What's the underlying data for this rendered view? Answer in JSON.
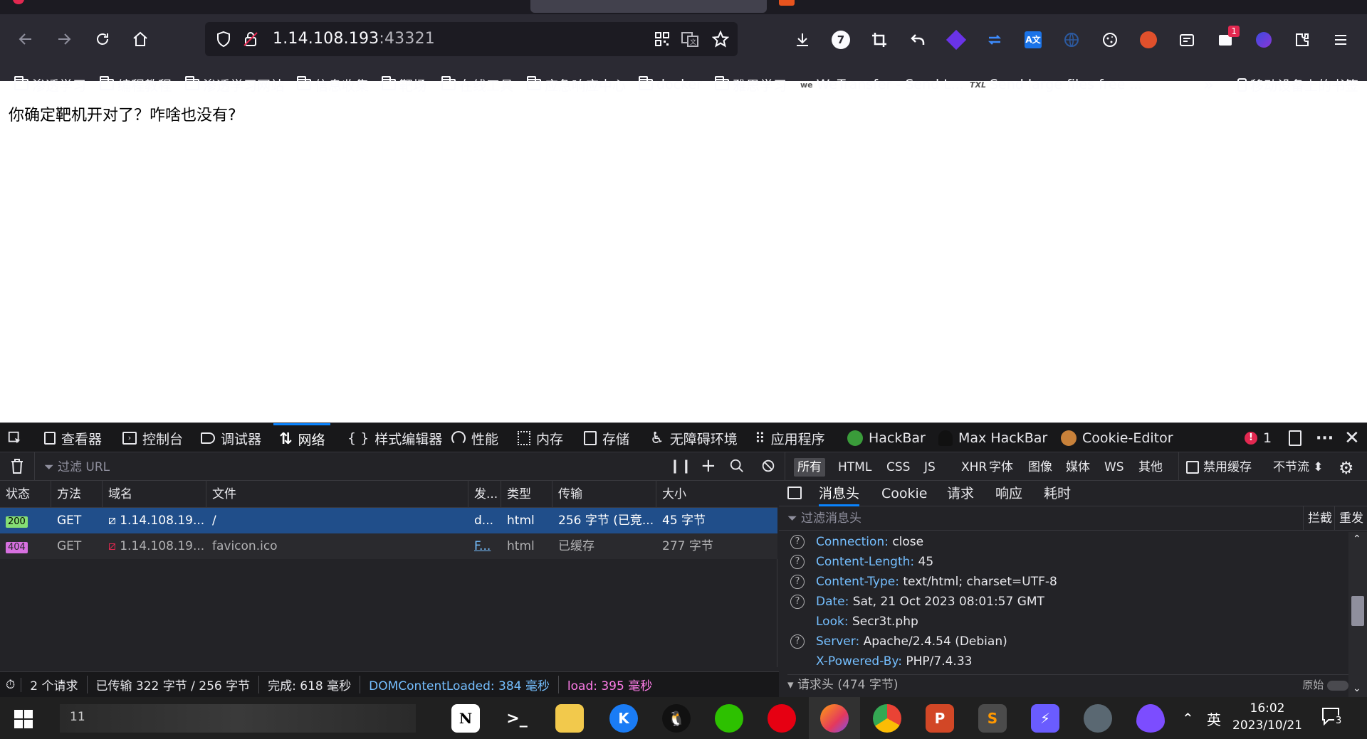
{
  "browser": {
    "url_host": "1.14.108.193",
    "url_port": ":43321",
    "bookmarks": [
      "渗透学习",
      "编程教程",
      "渗透学习网站",
      "信息收集",
      "靶场",
      "在线工具",
      "应急响应中心",
      "docker",
      "雅思学习",
      "WeTransfer - Send L...",
      "Send large files free ...",
      "移动设备上的书签"
    ],
    "ext_badge": "1",
    "num_badge": "7"
  },
  "page": {
    "message": "你确定靶机开对了？咋啥也没有?"
  },
  "devtools": {
    "tabs": [
      "查看器",
      "控制台",
      "调试器",
      "网络",
      "样式编辑器",
      "性能",
      "内存",
      "存储",
      "无障碍环境",
      "应用程序",
      "HackBar",
      "Max HackBar",
      "Cookie-Editor"
    ],
    "error_count": "1",
    "filter_placeholder": "过滤 URL",
    "type_filters": [
      "所有",
      "HTML",
      "CSS",
      "JS",
      "XHR",
      "字体",
      "图像",
      "媒体",
      "WS",
      "其他"
    ],
    "disable_cache": "禁用缓存",
    "throttle": "不节流 ⬍",
    "columns": [
      "状态",
      "方法",
      "域名",
      "文件",
      "发...",
      "类型",
      "传输",
      "大小"
    ],
    "requests": [
      {
        "status": "200",
        "method": "GET",
        "domain": "1.14.108.19...",
        "file": "/",
        "initiator": "d...",
        "type": "html",
        "transfer": "256 字节 (已竞...",
        "size": "45 字节"
      },
      {
        "status": "404",
        "method": "GET",
        "domain": "1.14.108.19...",
        "file": "favicon.ico",
        "initiator": "F...",
        "type": "html",
        "transfer": "已缓存",
        "size": "277 字节"
      }
    ],
    "detail_tabs": [
      "消息头",
      "Cookie",
      "请求",
      "响应",
      "耗时"
    ],
    "header_filter": "过滤消息头",
    "block": "拦截",
    "resend": "重发",
    "headers": [
      {
        "key": "Connection:",
        "value": "close",
        "help": true
      },
      {
        "key": "Content-Length:",
        "value": "45",
        "help": true
      },
      {
        "key": "Content-Type:",
        "value": "text/html; charset=UTF-8",
        "help": true
      },
      {
        "key": "Date:",
        "value": "Sat, 21 Oct 2023 08:01:57 GMT",
        "help": true
      },
      {
        "key": "Look:",
        "value": "Secr3t.php",
        "help": false
      },
      {
        "key": "Server:",
        "value": "Apache/2.4.54 (Debian)",
        "help": true
      },
      {
        "key": "X-Powered-By:",
        "value": "PHP/7.4.33",
        "help": false
      }
    ],
    "request_headers_label": "请求头 (474 字节)",
    "raw_label": "原始",
    "status": {
      "requests": "2 个请求",
      "transferred": "已传输 322 字节 / 256 字节",
      "finish": "完成: 618 毫秒",
      "dcl": "DOMContentLoaded: 384 毫秒",
      "load": "load: 395 毫秒"
    }
  },
  "taskbar": {
    "search_num": "11",
    "lang": "英",
    "time": "16:02",
    "date": "2023/10/21",
    "notif": "3"
  }
}
